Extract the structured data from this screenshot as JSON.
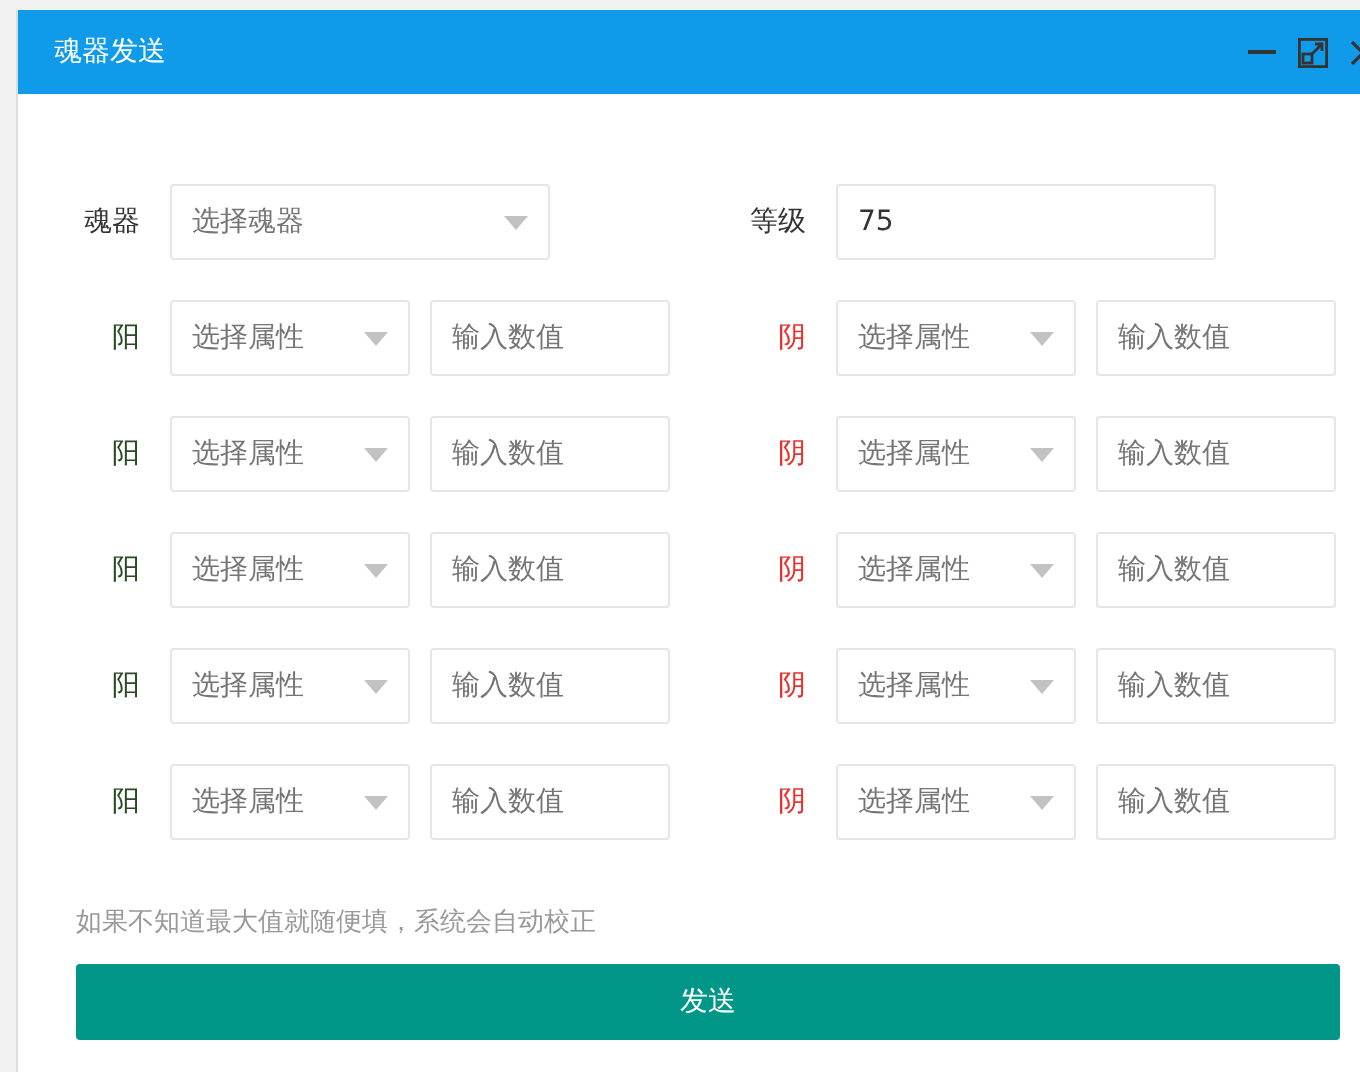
{
  "window": {
    "title": "魂器发送"
  },
  "soul_device": {
    "label": "魂器",
    "placeholder": "选择魂器"
  },
  "level_field": {
    "label": "等级",
    "value": "75"
  },
  "attribute_rows": [
    {
      "entries": [
        {
          "label": "阳",
          "color": "#2a4a22",
          "select_placeholder": "选择属性",
          "input_placeholder": "输入数值"
        },
        {
          "label": "阴",
          "color": "#e5342f",
          "select_placeholder": "选择属性",
          "input_placeholder": "输入数值"
        }
      ]
    },
    {
      "entries": [
        {
          "label": "阳",
          "color": "#2a4a22",
          "select_placeholder": "选择属性",
          "input_placeholder": "输入数值"
        },
        {
          "label": "阴",
          "color": "#e5342f",
          "select_placeholder": "选择属性",
          "input_placeholder": "输入数值"
        }
      ]
    },
    {
      "entries": [
        {
          "label": "阳",
          "color": "#2a4a22",
          "select_placeholder": "选择属性",
          "input_placeholder": "输入数值"
        },
        {
          "label": "阴",
          "color": "#e5342f",
          "select_placeholder": "选择属性",
          "input_placeholder": "输入数值"
        }
      ]
    },
    {
      "entries": [
        {
          "label": "阳",
          "color": "#2a4a22",
          "select_placeholder": "选择属性",
          "input_placeholder": "输入数值"
        },
        {
          "label": "阴",
          "color": "#e5342f",
          "select_placeholder": "选择属性",
          "input_placeholder": "输入数值"
        }
      ]
    },
    {
      "entries": [
        {
          "label": "阳",
          "color": "#2a4a22",
          "select_placeholder": "选择属性",
          "input_placeholder": "输入数值"
        },
        {
          "label": "阴",
          "color": "#e5342f",
          "select_placeholder": "选择属性",
          "input_placeholder": "输入数值"
        }
      ]
    }
  ],
  "hint": "如果不知道最大值就随便填，系统会自动校正",
  "submit_button": "发送"
}
